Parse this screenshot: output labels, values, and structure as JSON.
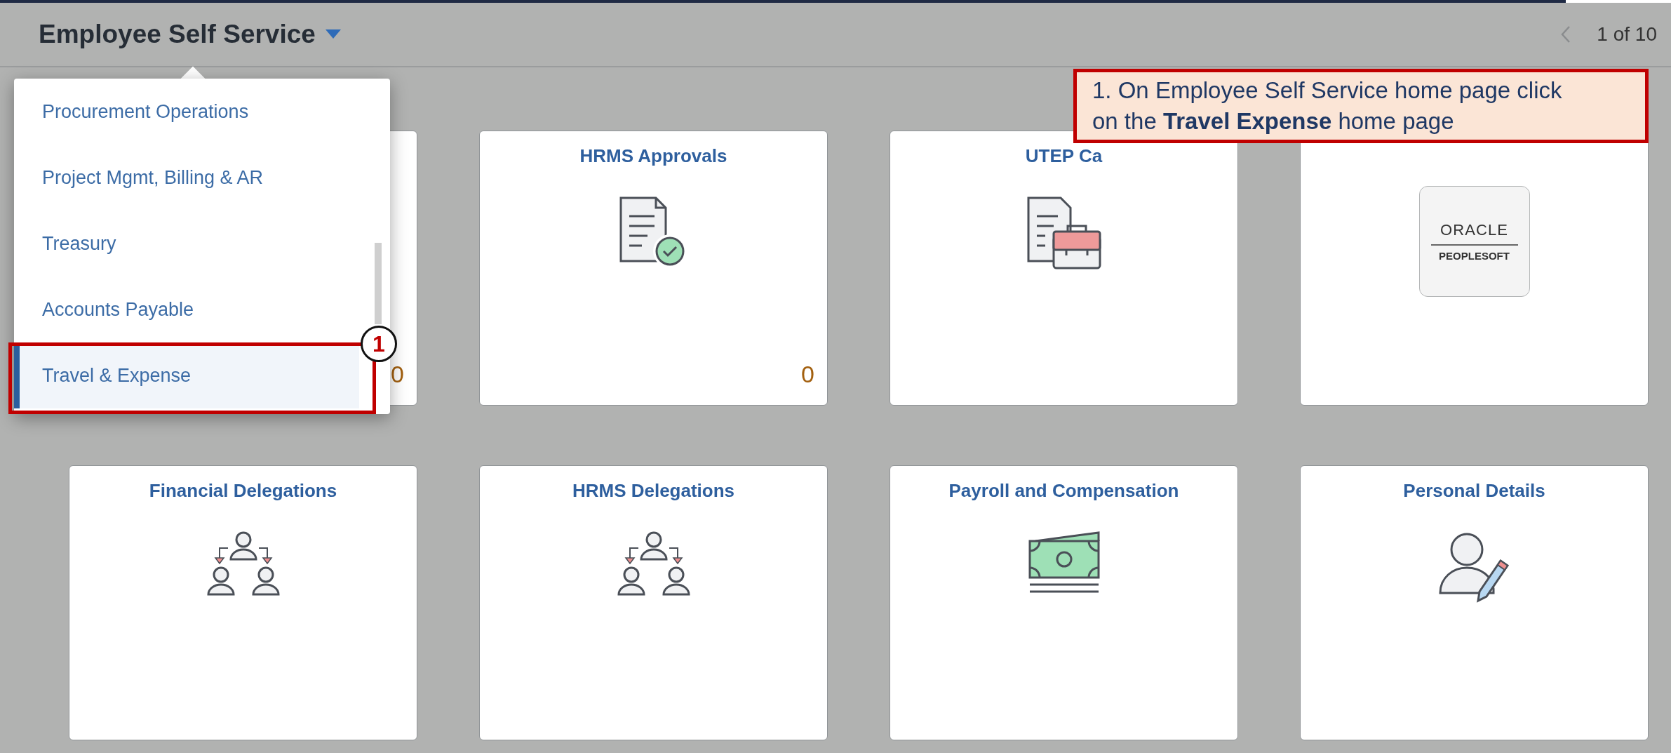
{
  "header": {
    "title": "Employee Self Service",
    "pager": "1 of 10"
  },
  "menu": {
    "items": [
      {
        "label": "Procurement Operations",
        "selected": false
      },
      {
        "label": "Project Mgmt, Billing & AR",
        "selected": false
      },
      {
        "label": "Treasury",
        "selected": false
      },
      {
        "label": "Accounts Payable",
        "selected": false
      },
      {
        "label": "Travel & Expense",
        "selected": true
      }
    ]
  },
  "tiles": [
    {
      "kind": "blank",
      "count": "0"
    },
    {
      "kind": "approvals",
      "title": "HRMS Approvals",
      "count": "0"
    },
    {
      "kind": "briefcase",
      "title": "UTEP Ca"
    },
    {
      "kind": "logo",
      "logo_top": "ORACLE",
      "logo_bottom": "PEOPLESOFT"
    },
    {
      "kind": "delegation",
      "title": "Financial Delegations"
    },
    {
      "kind": "delegation",
      "title": "HRMS Delegations"
    },
    {
      "kind": "money",
      "title": "Payroll and Compensation"
    },
    {
      "kind": "person",
      "title": "Personal Details"
    }
  ],
  "callout": {
    "step": "1",
    "text": "1. On Employee Self Service home page click on the **Travel Expense** home page"
  }
}
